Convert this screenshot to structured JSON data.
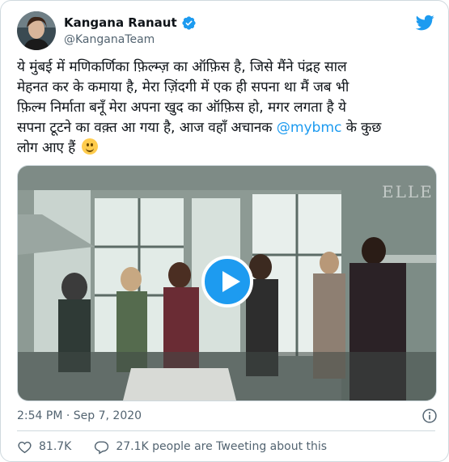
{
  "author": {
    "display_name": "Kangana Ranaut",
    "handle": "@KanganaTeam",
    "verified": true
  },
  "tweet": {
    "text_before_mention": "ये मुंबई में मणिकर्णिका फ़िल्म्ज़ का ऑफ़िस है, जिसे मैंने पंद्रह साल\nमेहनत कर के कमाया है, मेरा ज़िंदगी में एक ही सपना था मैं जब भी\nफ़िल्म निर्माता बनूँ मेरा अपना खुद का ऑफ़िस हो, मगर लगता है ये\nसपना टूटने का वक़्त आ गया है, आज वहाँ अचानक ",
    "mention": "@mybmc",
    "text_after_mention": " के कुछ\nलोग आए हैं ",
    "emoji": "slightly-smiling-face"
  },
  "media": {
    "type": "video",
    "watermark": "ELLE"
  },
  "meta": {
    "timestamp": "2:54 PM · Sep 7, 2020"
  },
  "actions": {
    "likes": "81.7K",
    "reply_text": "27.1K people are Tweeting about this"
  },
  "colors": {
    "accent": "#1d9bf0",
    "text": "#0f1419",
    "secondary": "#536471",
    "border": "#cfd9de"
  },
  "icons": [
    "verified-badge-icon",
    "twitter-bird-icon",
    "play-icon",
    "info-icon",
    "heart-icon",
    "reply-bubble-icon"
  ]
}
